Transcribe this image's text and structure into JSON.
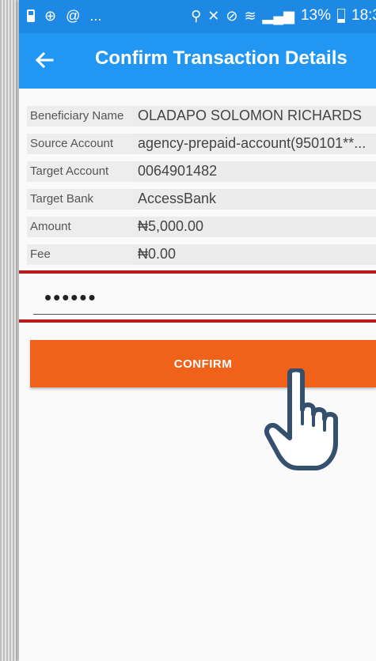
{
  "status_bar": {
    "left_icons": [
      "battery-icon",
      "at-sign-icon",
      "at-sign-icon"
    ],
    "overflow": "...",
    "battery_percent": "13%",
    "time": "18:3"
  },
  "app_bar": {
    "title": "Confirm Transaction Details",
    "back_icon": "arrow-left-icon"
  },
  "details": [
    {
      "label": "Beneficiary Name",
      "value": "OLADAPO SOLOMON RICHARDS"
    },
    {
      "label": "Source Account",
      "value": "agency-prepaid-account(950101**..."
    },
    {
      "label": "Target Account",
      "value": "0064901482"
    },
    {
      "label": "Target Bank",
      "value": "AccessBank"
    },
    {
      "label": "Amount",
      "value": "₦5,000.00"
    },
    {
      "label": "Fee",
      "value": "₦0.00"
    }
  ],
  "pin_field": {
    "value": "••••••"
  },
  "confirm_button": {
    "label": "CONFIRM"
  },
  "colors": {
    "status_bar": "#1e88e5",
    "app_bar": "#2196f3",
    "confirm": "#f06119",
    "highlight": "#b71c1c",
    "hand": "#35506e"
  }
}
